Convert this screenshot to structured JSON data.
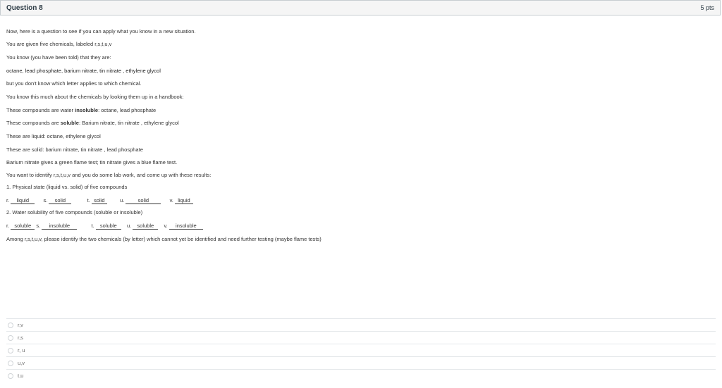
{
  "question": {
    "title": "Question 8",
    "points": "5 pts"
  },
  "lines": {
    "l1": "Now, here is a question to see if you can apply what you know in a new situation.",
    "l2": "You are given five chemicals, labeled  r,s,t,u,v",
    "l3": "You know (you have been told) that they are:",
    "l4": "octane, lead phosphate, barium nitrate, tin nitrate , ethylene glycol",
    "l5": "but you don't know which letter applies to which chemical.",
    "l6": "You know this much about the chemicals by looking them up in a handbook:",
    "l7a": "These compounds are water ",
    "l7b": "insoluble",
    "l7c": ":  octane, lead phosphate",
    "l8a": "These compounds are ",
    "l8b": "soluble",
    "l8c": ":  Barium nitrate, tin nitrate , ethylene glycol",
    "l9": "These are liquid: octane,  ethylene glycol",
    "l10": "These are solid: barium nitrate, tin nitrate , lead phosphate",
    "l11": "Barium nitrate gives a green flame test; tin nitrate gives a blue flame test.",
    "l12": "You want to identify  r,s,t,u,v and you do some lab work, and come up with these results:",
    "l13": "1.  Physical state (liquid vs. solid) of five compounds",
    "l15": "2.  Water solubility of five compounds (soluble or insoluble)",
    "l17": "Among r,s,t,u,v, please identify the two chemicals (by letter)  which cannot yet be identified  and need further testing (maybe flame tests)"
  },
  "state_results": [
    {
      "letter": "r.",
      "value": "liquid"
    },
    {
      "letter": "s.",
      "value": "solid"
    },
    {
      "letter": "t.",
      "value": "solid"
    },
    {
      "letter": "u.",
      "value": "solid"
    },
    {
      "letter": "v.",
      "value": "liquid"
    }
  ],
  "solubility_results": [
    {
      "letter": "r.",
      "value": "soluble"
    },
    {
      "letter": "s.",
      "value": "insoluble"
    },
    {
      "letter": "t.",
      "value": "soluble"
    },
    {
      "letter": "u.",
      "value": "soluble"
    },
    {
      "letter": "v.",
      "value": "insoluble"
    }
  ],
  "answers": [
    "r,v",
    "r,s",
    "r, u",
    "u,v",
    "t,u"
  ]
}
